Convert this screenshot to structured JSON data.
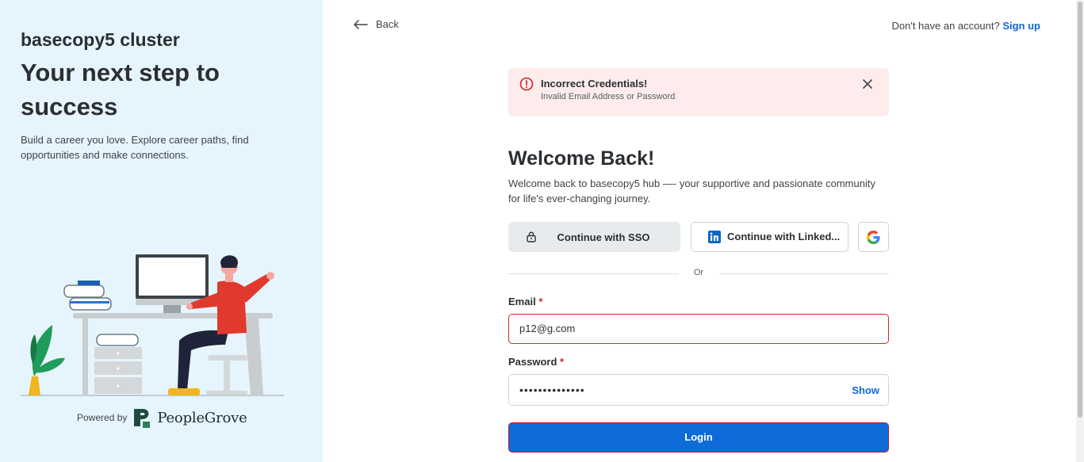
{
  "left_panel": {
    "cluster_name": "basecopy5 cluster",
    "headline": "Your next step to success",
    "tagline": "Build a career you love. Explore career paths, find opportunities and make connections.",
    "powered_by_label": "Powered by",
    "brand_name": "PeopleGrove"
  },
  "header": {
    "back_label": "Back",
    "no_account_text": "Don't have an account?",
    "signup_label": "Sign up"
  },
  "alert": {
    "title": "Incorrect Credentials!",
    "description": "Invalid Email Address or Password",
    "icon": "error-circle-icon"
  },
  "form": {
    "welcome_title": "Welcome Back!",
    "welcome_subtitle": "Welcome back to basecopy5 hub —- your supportive and passionate community for life's ever-changing journey.",
    "sso_label": "Continue with SSO",
    "linkedin_label": "Continue with Linked...",
    "divider_text": "Or",
    "email_label": "Email",
    "email_value": "p12@g.com",
    "password_label": "Password",
    "password_value": "••••••••••••••",
    "show_label": "Show",
    "required_mark": "*",
    "login_label": "Login"
  },
  "colors": {
    "left_bg": "#e6f5fd",
    "accent": "#0f6bd8",
    "error": "#d3242c",
    "alert_bg": "#fdeceb"
  }
}
